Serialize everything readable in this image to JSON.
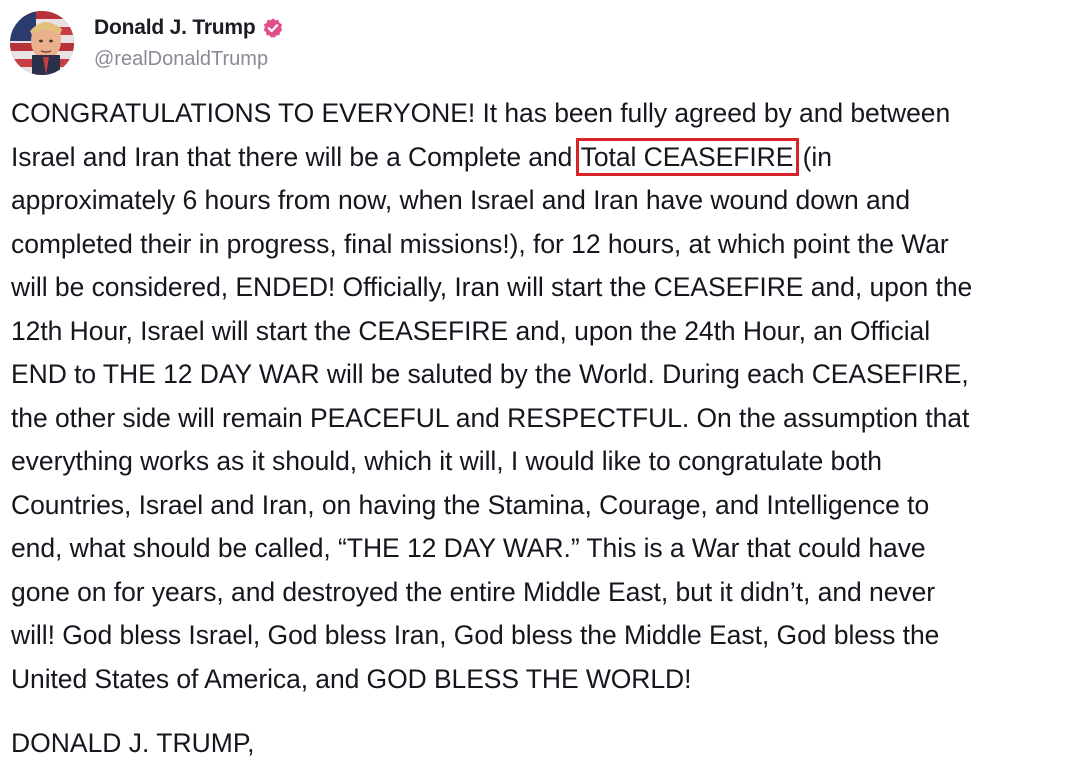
{
  "account": {
    "display_name": "Donald J. Trump",
    "handle": "@realDonaldTrump",
    "avatar_icon": "profile-photo-icon",
    "verified_icon": "verified-badge-icon",
    "verified_color": "#e04f8a"
  },
  "post": {
    "lines": [
      "CONGRATULATIONS TO EVERYONE! It has been fully agreed by and between",
      "Israel and Iran that there will be a Complete and ",
      "approximately 6 hours from now, when Israel and Iran have wound down and",
      "completed their in progress, final missions!), for 12 hours, at which point the War",
      "will be considered, ENDED! Officially, Iran will start the CEASEFIRE and, upon the",
      "12th Hour, Israel will start the CEASEFIRE and, upon the 24th Hour, an Official",
      "END to THE 12 DAY WAR will be saluted by the World. During each CEASEFIRE,",
      "the other side will remain PEACEFUL and RESPECTFUL. On the assumption that",
      "everything works as it should, which it will, I would like to congratulate both",
      "Countries, Israel and Iran, on having the Stamina, Courage, and Intelligence to",
      "end, what should be called, “THE 12 DAY WAR.” This is a War that could have",
      "gone on for years, and destroyed the entire Middle East, but it didn’t, and never",
      "will! God bless Israel, God bless Iran, God bless the Middle East, God bless the",
      "United States of America, and GOD BLESS THE WORLD!"
    ],
    "highlighted_phrase": "Total CEASEFIRE",
    "line2_after_highlight": " (in",
    "highlight_color": "#d9232a",
    "signature": "DONALD J. TRUMP,"
  }
}
